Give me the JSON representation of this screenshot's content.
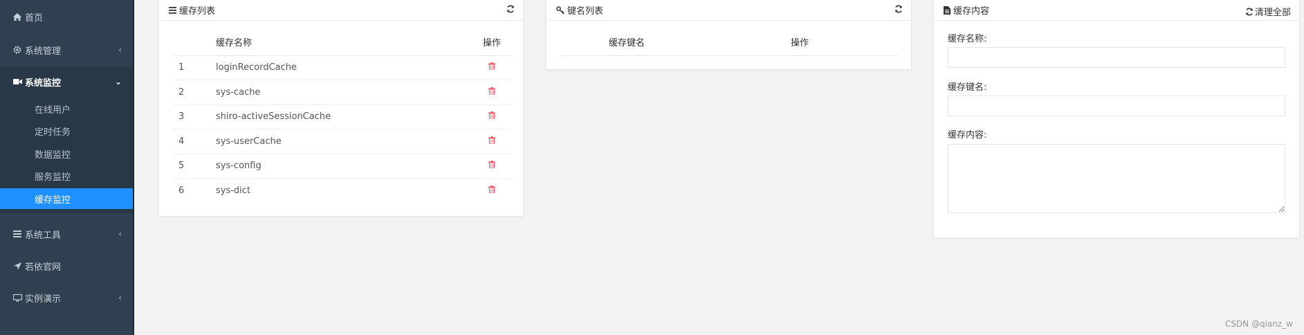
{
  "sidebar": {
    "items": [
      {
        "label": "首页",
        "icon": "home-icon"
      },
      {
        "label": "系统管理",
        "icon": "gear-icon"
      },
      {
        "label": "系统监控",
        "icon": "video-icon"
      },
      {
        "label": "系统工具",
        "icon": "bars-icon"
      },
      {
        "label": "若依官网",
        "icon": "location-arrow-icon"
      },
      {
        "label": "实例演示",
        "icon": "desktop-icon"
      }
    ],
    "submenu": [
      {
        "label": "在线用户"
      },
      {
        "label": "定时任务"
      },
      {
        "label": "数据监控"
      },
      {
        "label": "服务监控"
      },
      {
        "label": "缓存监控"
      }
    ]
  },
  "cache_list": {
    "title": "缓存列表",
    "columns": [
      "缓存名称",
      "操作"
    ],
    "rows": [
      {
        "index": "1",
        "name": "loginRecordCache"
      },
      {
        "index": "2",
        "name": "sys-cache"
      },
      {
        "index": "3",
        "name": "shiro-activeSessionCache"
      },
      {
        "index": "4",
        "name": "sys-userCache"
      },
      {
        "index": "5",
        "name": "sys-config"
      },
      {
        "index": "6",
        "name": "sys-dict"
      }
    ]
  },
  "key_list": {
    "title": "键名列表",
    "columns": [
      "缓存键名",
      "操作"
    ]
  },
  "cache_content": {
    "title": "缓存内容",
    "clear_all_label": "清理全部",
    "cache_name_label": "缓存名称:",
    "cache_key_label": "缓存键名:",
    "cache_value_label": "缓存内容:",
    "cache_name_value": "",
    "cache_key_value": "",
    "cache_value_value": ""
  },
  "watermark": "CSDN @qianz_w",
  "colors": {
    "sidebar_bg": "#2f4050",
    "active_blue": "#1e90ff",
    "delete_red": "#ed5565"
  }
}
